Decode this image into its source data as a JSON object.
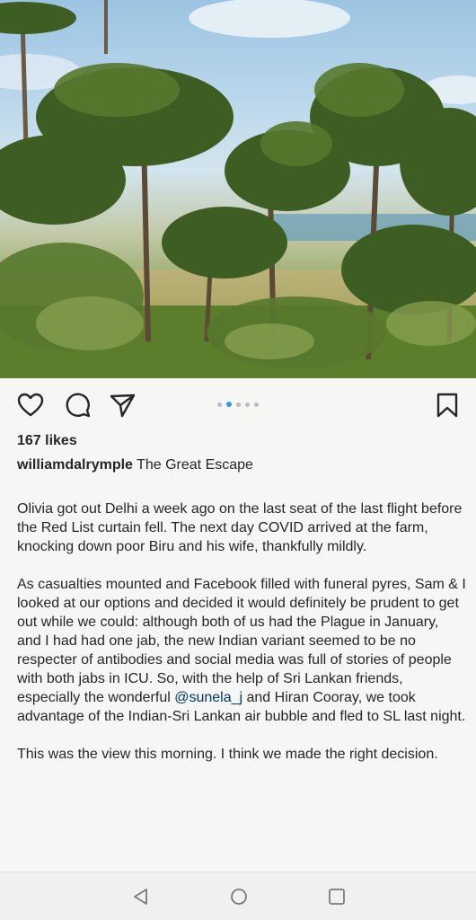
{
  "post": {
    "image_description_icons": [
      "heart-icon",
      "comment-icon",
      "share-icon",
      "bookmark-icon"
    ],
    "carousel": {
      "count": 5,
      "active": 2
    },
    "likes": "167 likes",
    "username": "williamdalrymple",
    "title": " The Great Escape",
    "paragraph1": "Olivia got out Delhi a week ago on the last seat of the last flight before the Red List curtain fell. The next day COVID arrived at the farm, knocking down poor Biru and his wife, thankfully mildly.",
    "paragraph2_before": "As casualties mounted and Facebook filled with funeral pyres, Sam & I looked at our options and decided it would definitely be prudent to get out while we could: although both of us had the Plague in January, and I had had one jab, the new Indian variant seemed to be no respecter of antibodies and social media was full of stories of people with both jabs in ICU. So, with the help of Sri Lankan friends, especially the wonderful ",
    "mention": "@sunela_j",
    "paragraph2_after": " and Hiran Cooray, we took advantage of the Indian-Sri Lankan air bubble and fled to SL last night.",
    "paragraph3": "This was the view this morning. I think we made the right decision."
  },
  "colors": {
    "text": "#262626",
    "mention": "#00376b",
    "active_dot": "#3897f0",
    "background": "#f6f7f4"
  }
}
